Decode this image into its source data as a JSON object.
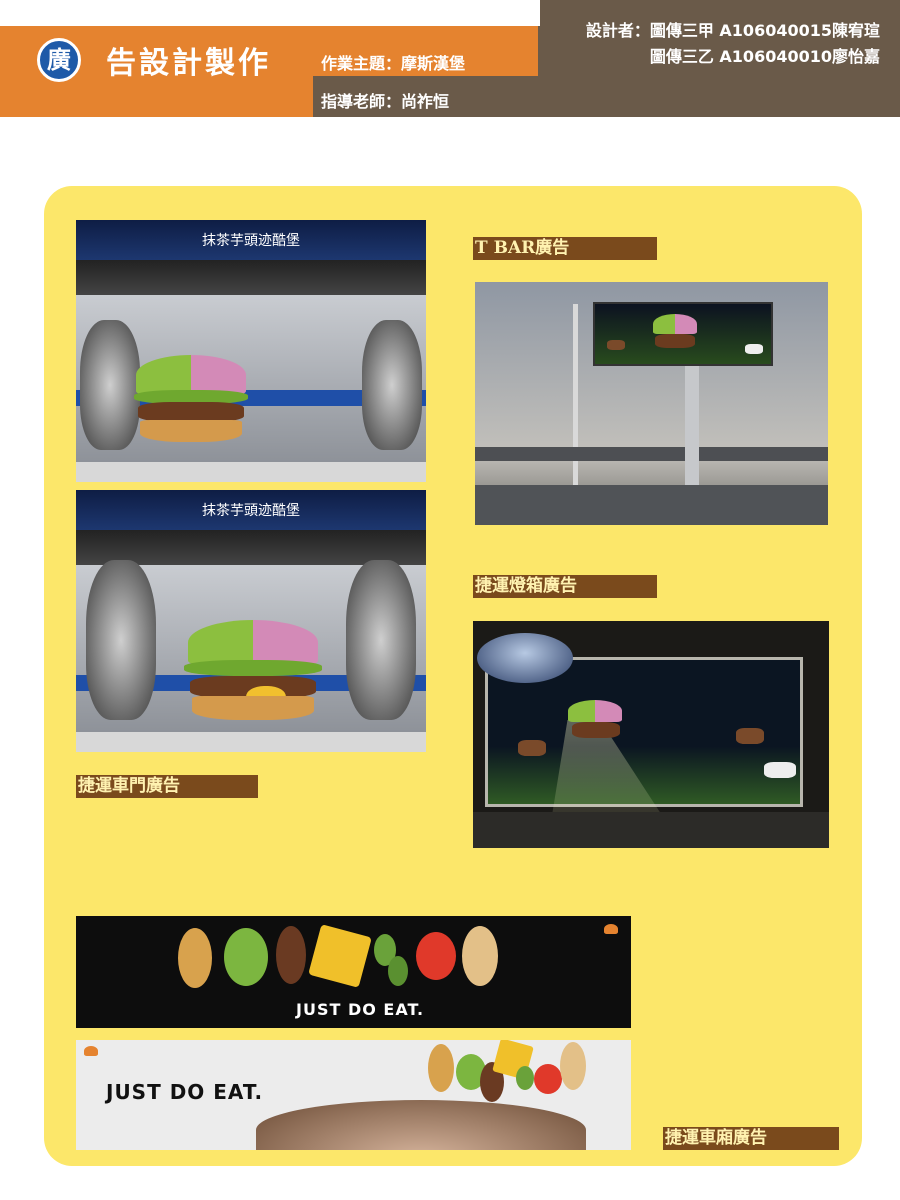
{
  "header": {
    "badge": "廣",
    "title": "告設計製作",
    "topic": "作業主題：摩斯漢堡",
    "teacher": "指導老師：尚祚恒",
    "designer_line1": "設計者：圖傳三甲 A106040015陳宥瑄",
    "designer_line2": "圖傳三乙 A106040010廖怡嘉"
  },
  "photos": {
    "mrt_sign_top": "抹茶芋頭迹酷堡",
    "mrt_sign_bottom": "抹茶芋頭迹酷堡",
    "banner_slogan": "JUST DO EAT.",
    "banner_slogan_2": "JUST DO EAT."
  },
  "labels": {
    "tbar": "T BAR廣告",
    "lightbox": "捷運燈箱廣告",
    "door": "捷運車門廣告",
    "carriage": "捷運車廂廣告"
  },
  "colors": {
    "orange": "#e5832f",
    "brown_gray": "#6a5a49",
    "yellow_panel": "#fce76a",
    "label_brown": "#7a4a1c",
    "badge_blue": "#1e5aa8"
  }
}
